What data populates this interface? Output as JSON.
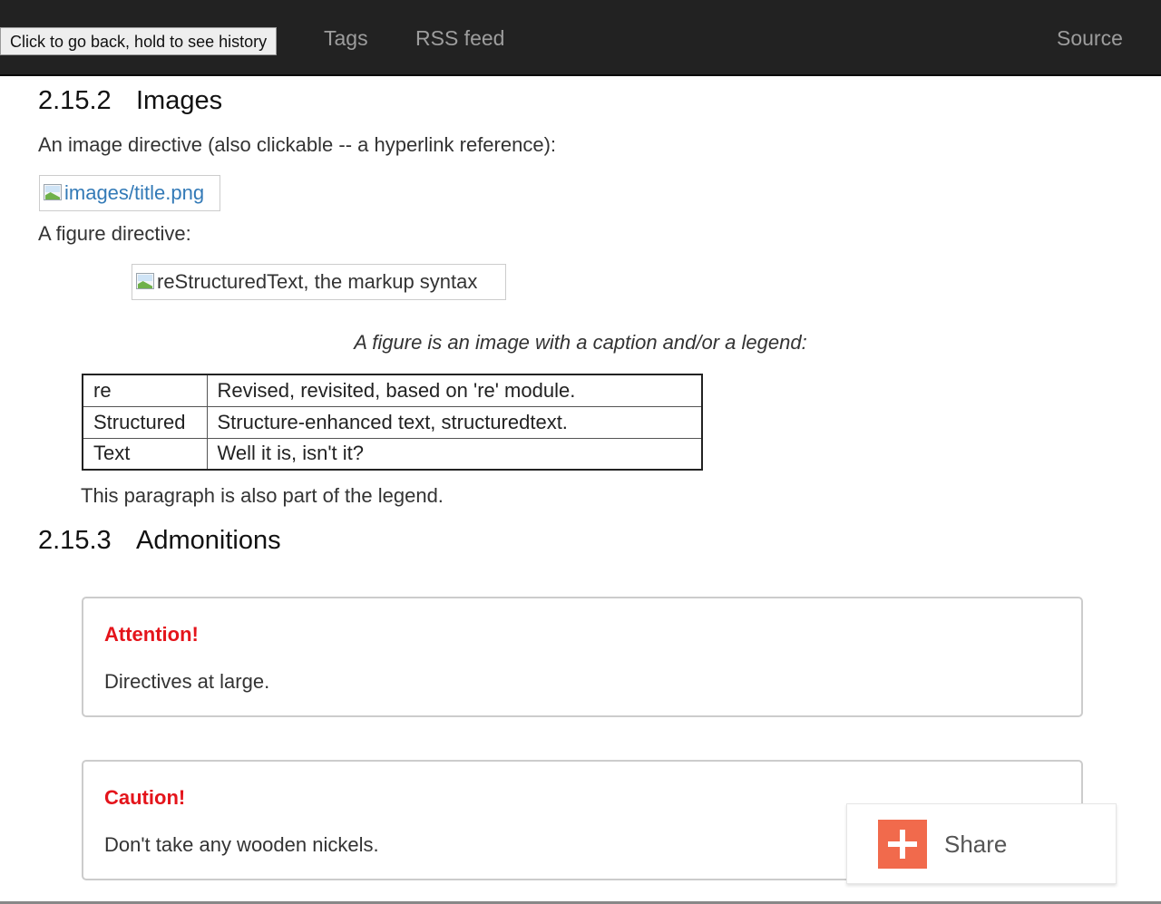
{
  "nav": {
    "tooltip": "Click to go back, hold to see history",
    "tags": "Tags",
    "rss": "RSS feed",
    "source": "Source"
  },
  "images_section": {
    "number": "2.15.2",
    "title": "Images",
    "intro": "An image directive (also clickable -- a hyperlink reference):",
    "image_alt": "images/title.png",
    "figure_intro": "A figure directive:",
    "figure_alt": "reStructuredText, the markup syntax",
    "caption": "A figure is an image with a caption and/or a legend:",
    "legend_rows": [
      {
        "term": "re",
        "definition": "Revised, revisited, based on 're' module."
      },
      {
        "term": "Structured",
        "definition": "Structure-enhanced text, structuredtext."
      },
      {
        "term": "Text",
        "definition": "Well it is, isn't it?"
      }
    ],
    "legend_paragraph": "This paragraph is also part of the legend."
  },
  "admonitions_section": {
    "number": "2.15.3",
    "title": "Admonitions",
    "items": [
      {
        "title": "Attention!",
        "body": "Directives at large."
      },
      {
        "title": "Caution!",
        "body": "Don't take any wooden nickels."
      }
    ]
  },
  "share": {
    "label": "Share",
    "icon": "plus-icon",
    "color": "#f16a4c"
  },
  "colors": {
    "navbar": "#222222",
    "link": "#337ab7",
    "admonition_title": "#e4141b"
  }
}
